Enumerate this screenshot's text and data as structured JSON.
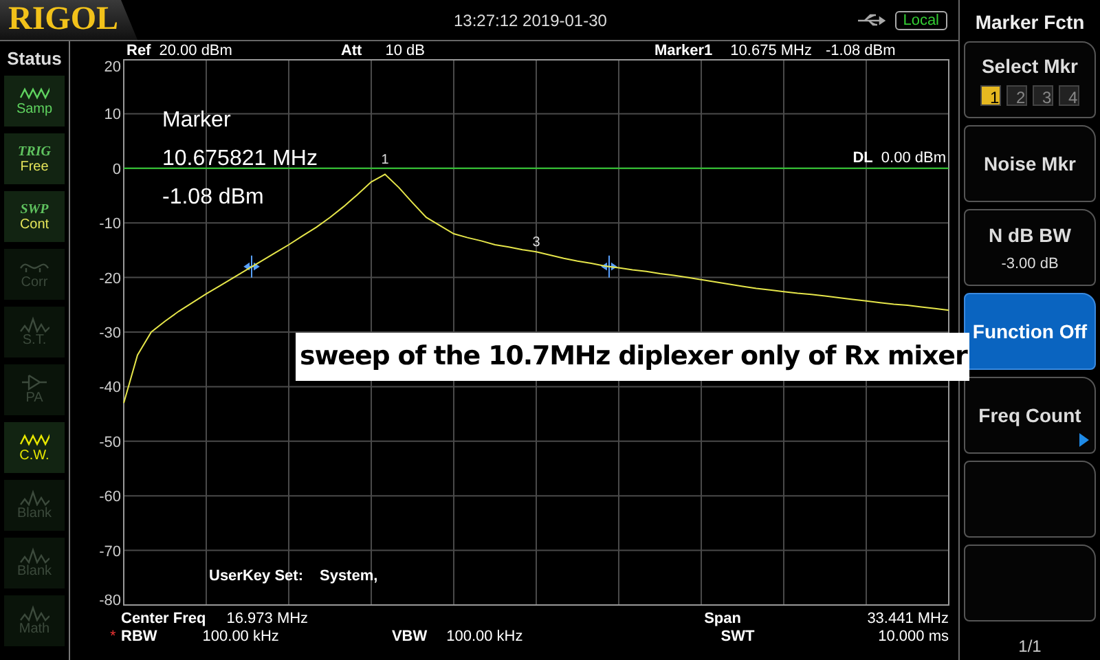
{
  "header": {
    "logo": "RIGOL",
    "datetime": "13:27:12 2019-01-30",
    "mode": "Local"
  },
  "status": {
    "title": "Status",
    "items": [
      {
        "kind": "wave",
        "label": "Samp",
        "color": "#5fd35f",
        "active": true
      },
      {
        "kind": "tag",
        "tag": "TRIG",
        "label": "Free",
        "color": "#e6e65a",
        "active": true
      },
      {
        "kind": "tag",
        "tag": "SWP",
        "label": "Cont",
        "color": "#e6e65a",
        "active": true
      },
      {
        "kind": "corr",
        "label": "Corr",
        "color": "#3c4a3c",
        "active": false
      },
      {
        "kind": "peak",
        "label": "S.T.",
        "color": "#3c4a3c",
        "active": false
      },
      {
        "kind": "amp",
        "label": "PA",
        "color": "#3c4a3c",
        "active": false
      },
      {
        "kind": "wave",
        "label": "C.W.",
        "color": "#e6e600",
        "active": true
      },
      {
        "kind": "peak",
        "label": "Blank",
        "color": "#3c4a3c",
        "active": false
      },
      {
        "kind": "peak",
        "label": "Blank",
        "color": "#3c4a3c",
        "active": false
      },
      {
        "kind": "peak",
        "label": "Math",
        "color": "#3c4a3c",
        "active": false
      }
    ]
  },
  "plot": {
    "ref_label": "Ref",
    "ref": "20.00 dBm",
    "att_label": "Att",
    "att": "10 dB",
    "marker_label": "Marker1",
    "marker_freq": "10.675 MHz",
    "marker_amp": "-1.08 dBm",
    "chart_data": {
      "type": "line",
      "categories": [
        null,
        null,
        null,
        null,
        null,
        null,
        null,
        null,
        null,
        null,
        null,
        null,
        null,
        null,
        null,
        null,
        null,
        null,
        null,
        null,
        null,
        null,
        null,
        null,
        null,
        null,
        null,
        null,
        null,
        null,
        null,
        null,
        null,
        null,
        null,
        null,
        null,
        null,
        null,
        null,
        null,
        null,
        null,
        null,
        null,
        null,
        null,
        null,
        null,
        null,
        null,
        null,
        null,
        null,
        null,
        null,
        null,
        null,
        null,
        null,
        null
      ],
      "series": [
        {
          "color": "#e6e64a",
          "values": [
            -43,
            -34.2,
            -30,
            -28,
            -26.2,
            -24.6,
            -23,
            -21.5,
            -20,
            -18.5,
            -17,
            -15.5,
            -14,
            -12.4,
            -10.8,
            -9,
            -7,
            -4.8,
            -2.5,
            -1.1,
            -3.5,
            -6.3,
            -9,
            -10.5,
            -12,
            -12.7,
            -13.3,
            -14,
            -14.4,
            -14.9,
            -15.3,
            -15.9,
            -16.5,
            -17,
            -17.4,
            -17.9,
            -18.2,
            -18.6,
            -18.9,
            -19.3,
            -19.6,
            -20,
            -20.4,
            -20.8,
            -21.2,
            -21.6,
            -22,
            -22.3,
            -22.6,
            -22.9,
            -23.1,
            -23.4,
            -23.7,
            -24,
            -24.3,
            -24.6,
            -24.9,
            -25.1,
            -25.4,
            -25.7,
            -26
          ]
        }
      ],
      "ylim": [
        -80,
        20
      ],
      "yticks": [
        {
          "value": 20,
          "label": "20"
        },
        {
          "value": 10,
          "label": "10"
        },
        {
          "value": 0,
          "label": "0"
        },
        {
          "value": -10,
          "label": "-10"
        },
        {
          "value": -20,
          "label": "-20"
        },
        {
          "value": -30,
          "label": "-30"
        },
        {
          "value": -40,
          "label": "-40"
        },
        {
          "value": -50,
          "label": "-50"
        },
        {
          "value": -60,
          "label": "-60"
        },
        {
          "value": -70,
          "label": "-70"
        },
        {
          "value": -80,
          "label": "-80"
        }
      ]
    },
    "readout": [
      "Marker",
      "10.675821 MHz",
      "-1.08 dBm"
    ],
    "display_line": {
      "label": "DL",
      "value": "0.00 dBm"
    },
    "markers": [
      {
        "label": "1"
      },
      {
        "label": "3"
      }
    ],
    "userkey": {
      "label": "UserKey Set:",
      "value": "System,"
    }
  },
  "footer": {
    "center_label": "Center Freq",
    "center": "16.973 MHz",
    "span_label": "Span",
    "span": "33.441 MHz",
    "rbw_flag": "*",
    "rbw_label": "RBW",
    "rbw": "100.00 kHz",
    "vbw_label": "VBW",
    "vbw": "100.00 kHz",
    "swt_label": "SWT",
    "swt": "10.000 ms"
  },
  "softkeys": {
    "title": "Marker Fctn",
    "keys": [
      {
        "kind": "select",
        "label": "Select Mkr",
        "selected": false,
        "markers": [
          {
            "label": "1",
            "selected": true
          },
          {
            "label": "2",
            "selected": false
          },
          {
            "label": "3",
            "selected": false
          },
          {
            "label": "4",
            "selected": false
          }
        ]
      },
      {
        "kind": "plain",
        "label": "Noise Mkr",
        "selected": false
      },
      {
        "kind": "value",
        "label": "N dB BW",
        "value": "-3.00 dB",
        "selected": false
      },
      {
        "kind": "plain",
        "label": "Function Off",
        "selected": true
      },
      {
        "kind": "submenu",
        "label": "Freq Count",
        "selected": false
      },
      {
        "kind": "empty"
      },
      {
        "kind": "empty"
      }
    ],
    "page": "1/1"
  },
  "annotation": {
    "text": "sweep of the 10.7MHz diplexer only of Rx mixer"
  }
}
